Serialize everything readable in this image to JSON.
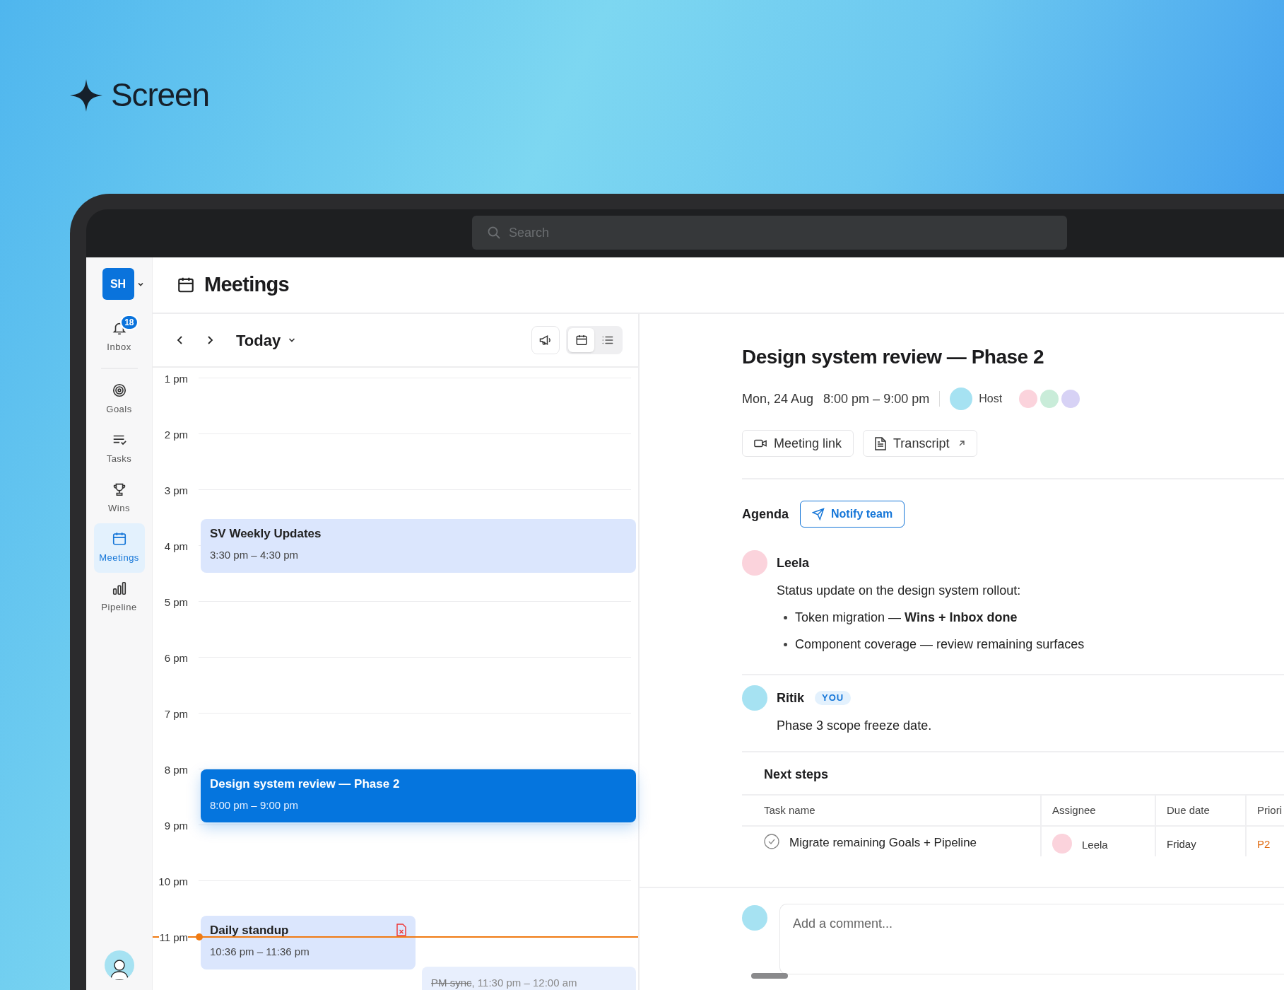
{
  "brand": {
    "name": "Screen"
  },
  "search": {
    "placeholder": "Search"
  },
  "workspace": {
    "initials": "SH"
  },
  "sidebar": {
    "items": [
      {
        "label": "Inbox",
        "badge": "18",
        "selected": false
      },
      {
        "label": "Goals",
        "selected": false
      },
      {
        "label": "Tasks",
        "selected": false
      },
      {
        "label": "Wins",
        "selected": false
      },
      {
        "label": "Meetings",
        "selected": true
      },
      {
        "label": "Pipeline",
        "selected": false
      }
    ]
  },
  "page": {
    "title": "Meetings"
  },
  "calendar": {
    "range_label": "Today",
    "views": [
      {
        "kind": "calendar",
        "selected": true
      },
      {
        "kind": "list",
        "selected": false
      }
    ],
    "hours": [
      "1 pm",
      "2 pm",
      "3 pm",
      "4 pm",
      "5 pm",
      "6 pm",
      "7 pm",
      "8 pm",
      "9 pm",
      "10 pm",
      "11 pm"
    ],
    "events": [
      {
        "title": "SV Weekly Updates",
        "time": "3:30 pm – 4:30 pm",
        "selected": false,
        "cancelled": false,
        "flag": false
      },
      {
        "title": "Design system review — Phase 2",
        "time": "8:00 pm – 9:00 pm",
        "selected": true,
        "cancelled": false,
        "flag": false
      },
      {
        "title": "Daily standup",
        "time": "10:36 pm – 11:36 pm",
        "selected": false,
        "cancelled": false,
        "flag": true
      },
      {
        "title": "PM sync",
        "time": ", 11:30 pm – 12:00 am",
        "selected": false,
        "cancelled": true,
        "flag": false
      }
    ]
  },
  "detail": {
    "title": "Design system review — Phase 2",
    "date": "Mon, 24 Aug",
    "time": "8:00 pm – 9:00 pm",
    "host_label": "Host",
    "buttons": [
      "Meeting link",
      "Transcript"
    ],
    "agenda_label": "Agenda",
    "notify_button": "Notify team",
    "comments": [
      {
        "author": "Leela",
        "text": "Status update on the design system rollout:",
        "bullets": [
          "Token migration — **Wins + Inbox done**",
          "Component coverage — review remaining surfaces"
        ]
      },
      {
        "author": "Ritik",
        "you_badge": "YOU",
        "text": "Phase 3 scope freeze date."
      }
    ],
    "next_steps": {
      "title": "Next steps",
      "columns": [
        "Task name",
        "Assignee",
        "Due date",
        "Priori"
      ],
      "rows": [
        {
          "done": false,
          "task": "Migrate remaining Goals + Pipeline",
          "assignee": "Leela",
          "due": "Friday",
          "priority": "P2"
        }
      ]
    },
    "comment_field": {
      "placeholder": "Add a comment..."
    }
  }
}
